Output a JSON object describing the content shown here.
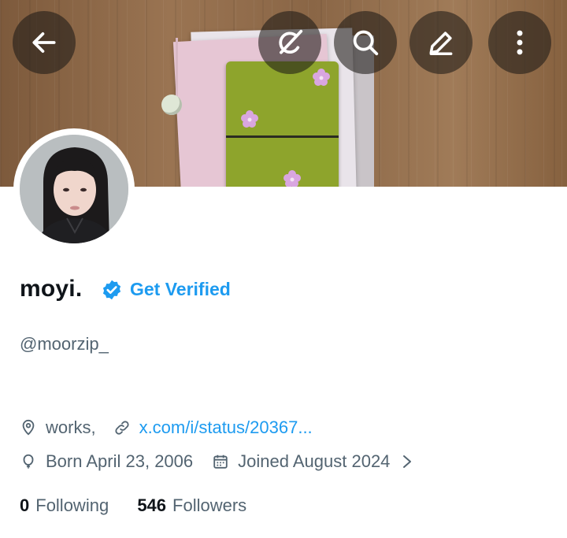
{
  "profile": {
    "display_name": "moyi.",
    "verify_cta": "Get Verified",
    "handle": "@moorzip_",
    "location": "works,",
    "website": "x.com/i/status/20367...",
    "birthday": "Born April 23, 2006",
    "joined": "Joined August 2024"
  },
  "stats": {
    "following_count": "0",
    "following_label": "Following",
    "followers_count": "546",
    "followers_label": "Followers"
  },
  "icons": {
    "back": "arrow-left-icon",
    "grok": "grok-icon",
    "search": "search-icon",
    "edit": "edit-icon",
    "more": "more-vertical-icon",
    "verified": "verified-badge-icon",
    "location": "location-pin-icon",
    "website": "link-icon",
    "birthday": "balloon-icon",
    "joined": "calendar-icon",
    "expand": "chevron-right-icon"
  },
  "colors": {
    "accent": "#1d9bf0",
    "text_primary": "#0f1419",
    "text_secondary": "#536471"
  }
}
